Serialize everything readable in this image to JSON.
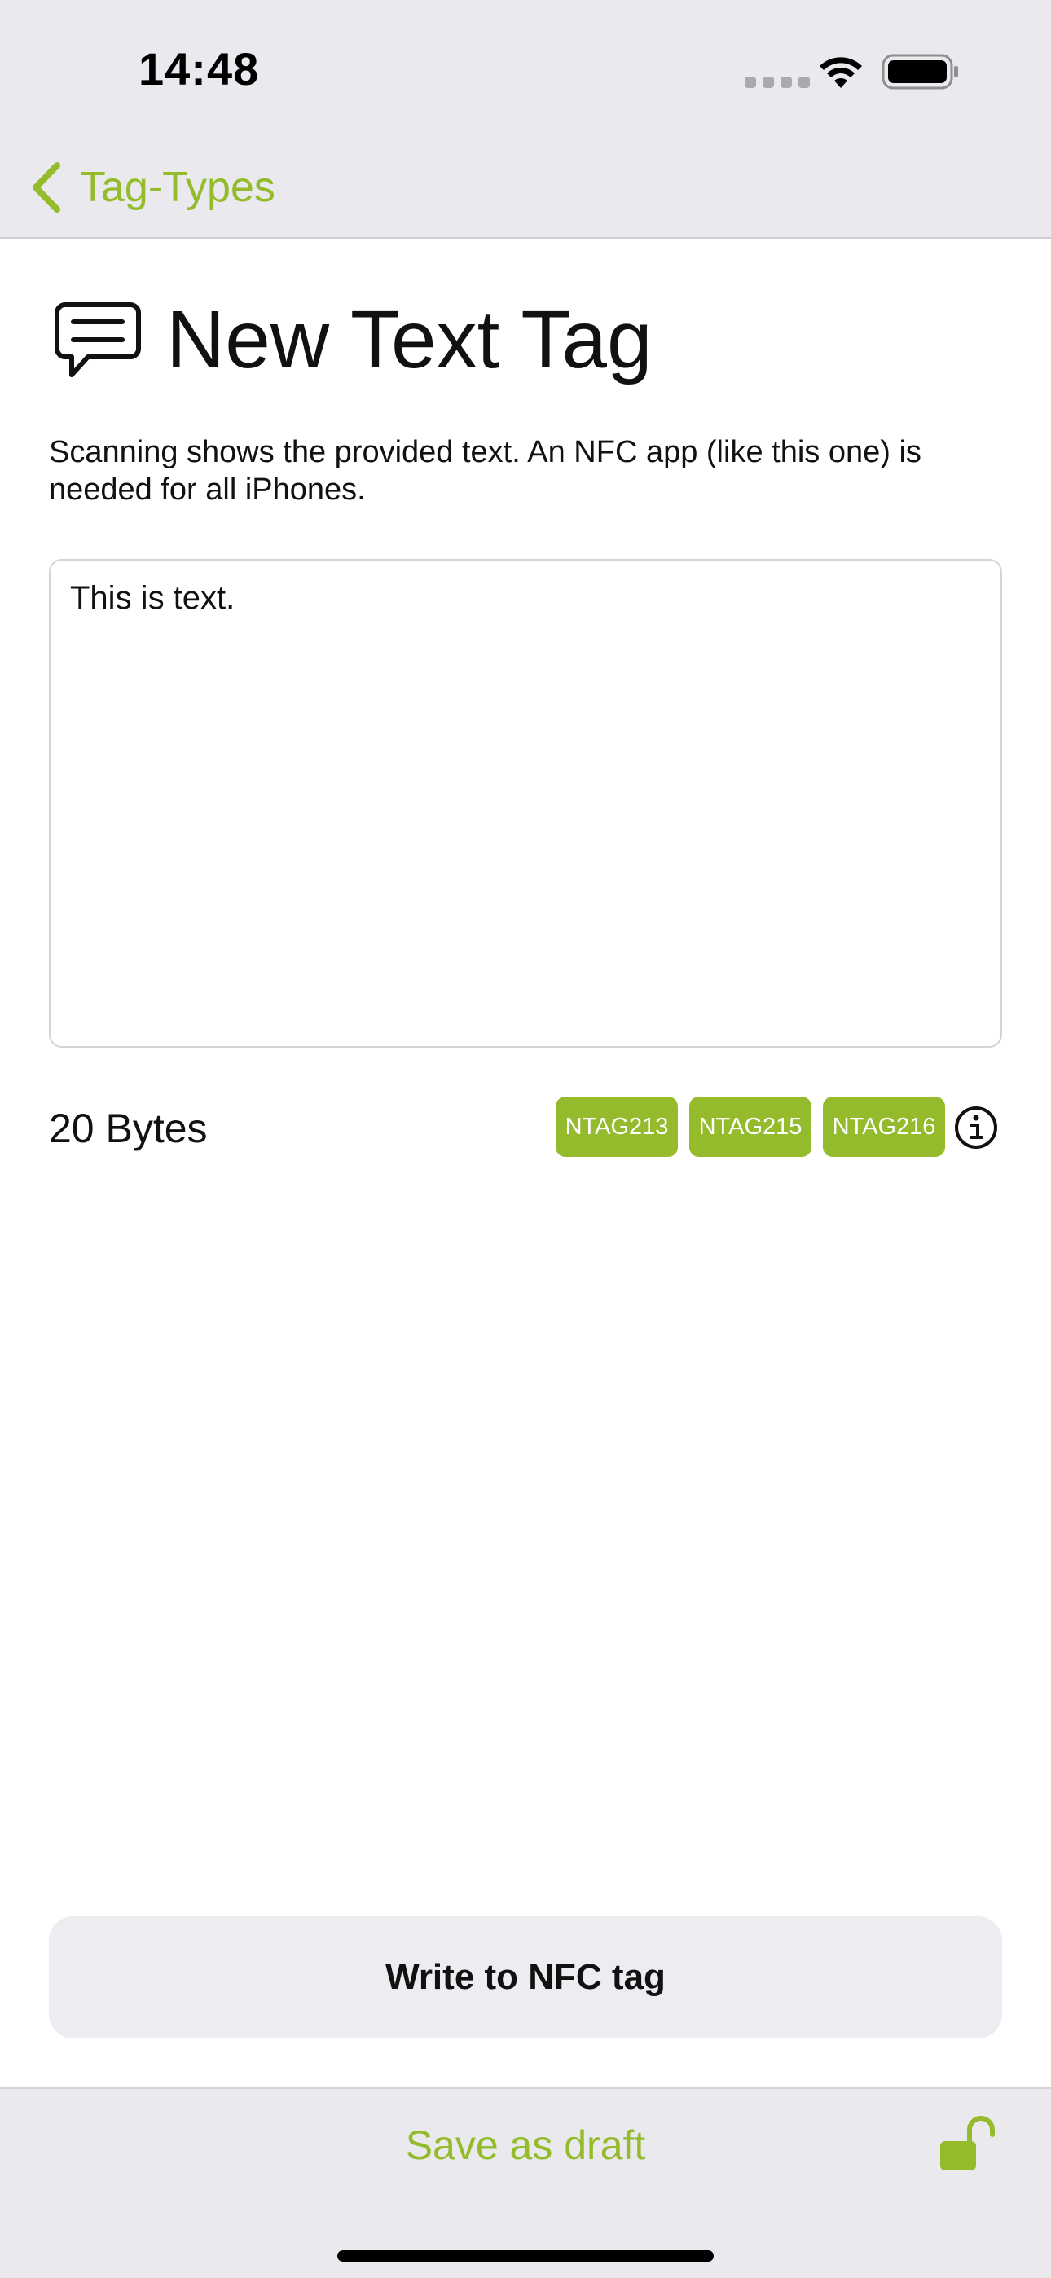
{
  "status_bar": {
    "time": "14:48"
  },
  "nav": {
    "back_label": "Tag-Types",
    "back_icon": "chevron-left-icon"
  },
  "header": {
    "icon": "message-bubble-icon",
    "title": "New Text Tag",
    "description": "Scanning shows the provided text. An NFC app (like this one) is needed for all iPhones."
  },
  "editor": {
    "value": "This is text."
  },
  "size": {
    "bytes_label": "20 Bytes",
    "chips": [
      "NTAG213",
      "NTAG215",
      "NTAG216"
    ],
    "info_icon": "info-circle-icon"
  },
  "actions": {
    "write_label": "Write to NFC tag",
    "save_draft_label": "Save as draft",
    "lock_icon": "unlocked-padlock-icon"
  },
  "colors": {
    "accent": "#94bc2a",
    "chip_background": "#93bb2b",
    "bar_background": "#e9e9ee",
    "write_button_background": "#ececf1"
  }
}
